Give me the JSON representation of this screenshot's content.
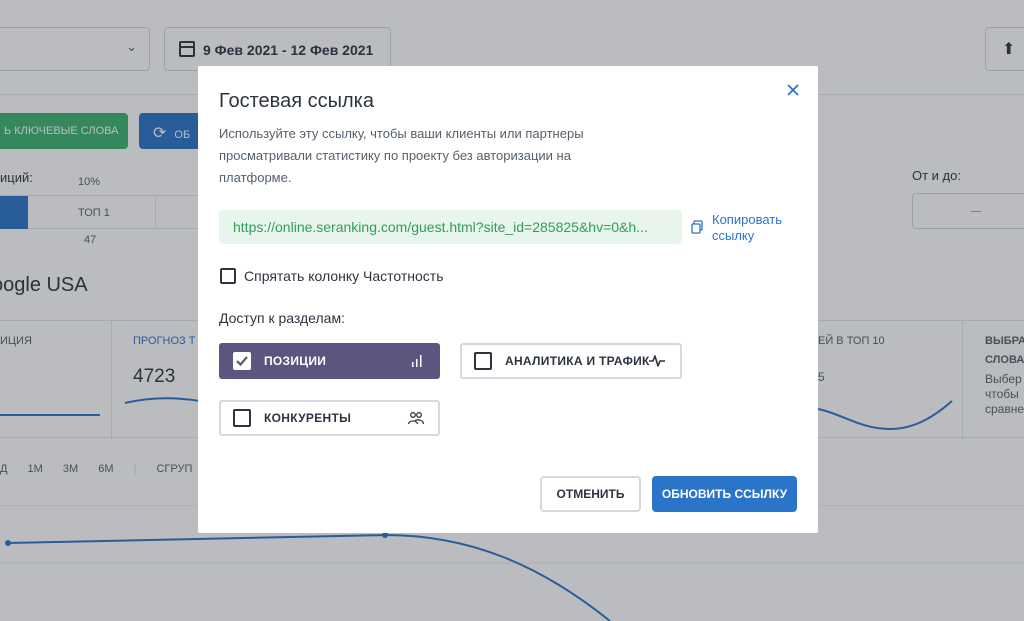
{
  "background": {
    "date_range": "9 Фев 2021 - 12 Фев 2021",
    "btn_keywords": "Ь КЛЮЧЕВЫЕ СЛОВА",
    "btn_update_partial": "ОБ",
    "label_positions": "иций:",
    "label_10": "10%",
    "label_top1": "ТОП 1",
    "label_47": "47",
    "engine_name": "oogle USA",
    "label_range": "От и до:",
    "stats": {
      "col1": "ИЦИЯ",
      "col2": "ПРОГНОЗ Т",
      "col2_value": "4723",
      "col3": "ЕЙ В ТОП 10",
      "col3_value": "5",
      "col4": "ВЫБРА",
      "col4_b": "СЛОВА",
      "col4_desc": [
        "Выбер",
        "чтобы",
        "сравне"
      ]
    },
    "periods": [
      "Д",
      "1М",
      "3М",
      "6М",
      "СГРУП"
    ]
  },
  "modal": {
    "title": "Гостевая ссылка",
    "description": "Используйте эту ссылку, чтобы ваши клиенты или партнеры просматривали статистику по проекту без авторизации на платформе.",
    "link": "https://online.seranking.com/guest.html?site_id=285825&hv=0&h...",
    "copy_label": "Копировать ссылку",
    "hide_column_label": "Спрятать колонку Частотность",
    "access_label": "Доступ к разделам:",
    "sections": [
      {
        "label": "ПОЗИЦИИ",
        "checked": true,
        "icon": "bar-chart-icon"
      },
      {
        "label": "АНАЛИТИКА И ТРАФИК",
        "checked": false,
        "icon": "pulse-icon"
      },
      {
        "label": "КОНКУРЕНТЫ",
        "checked": false,
        "icon": "users-icon"
      }
    ],
    "cancel_label": "ОТМЕНИТЬ",
    "update_label": "ОБНОВИТЬ ССЫЛКУ"
  },
  "colors": {
    "accent": "#2a74c9",
    "section_active": "#5b5680",
    "link_bg": "#e8f5ec",
    "link_text": "#2f9e5a",
    "green_button": "#3cb371"
  }
}
